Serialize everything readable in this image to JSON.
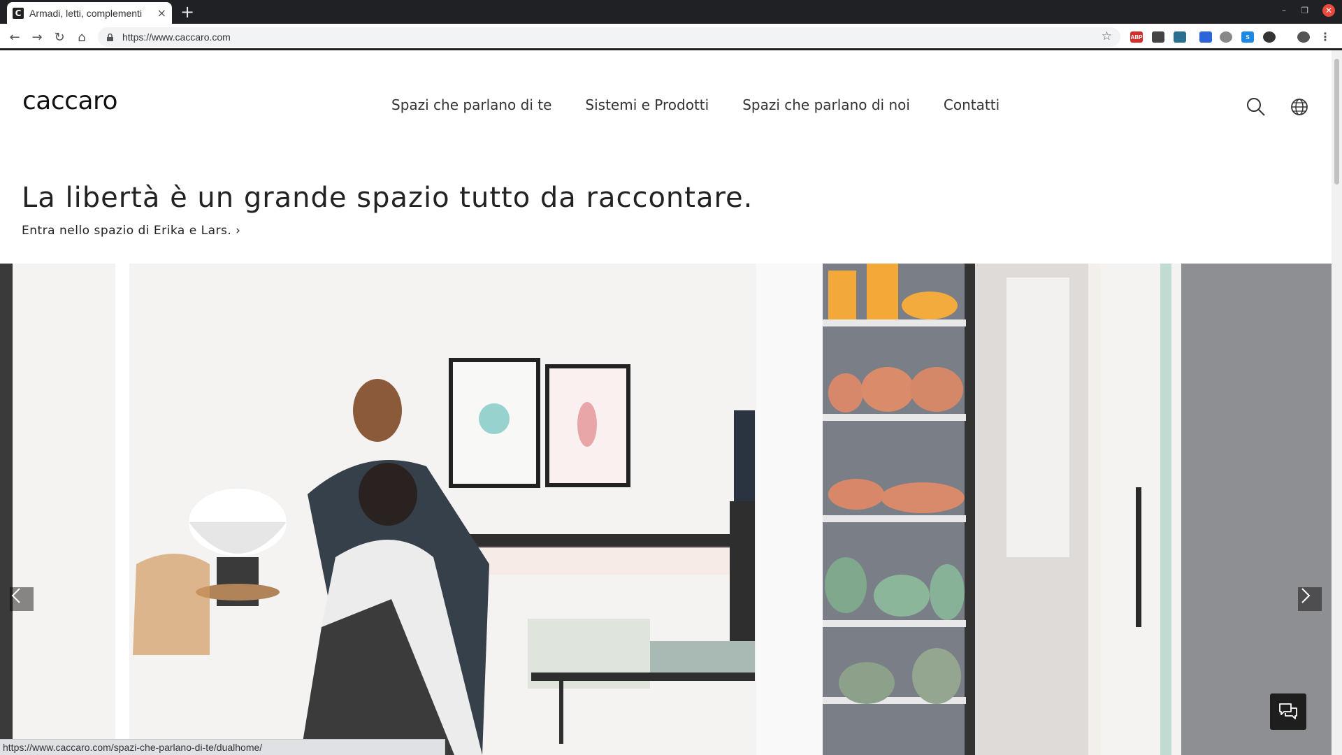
{
  "browser": {
    "tab_title": "Armadi, letti, complementi",
    "tab_close": "×",
    "new_tab": "+",
    "url": "https://www.caccaro.com",
    "status_url": "https://www.caccaro.com/spazi-che-parlano-di-te/dualhome/",
    "extensions": [
      "ABP",
      "",
      "",
      "",
      "",
      "S",
      "",
      ""
    ]
  },
  "site": {
    "logo": "caccaro",
    "nav": [
      "Spazi che parlano di te",
      "Sistemi e Prodotti",
      "Spazi che parlano di noi",
      "Contatti"
    ],
    "headline": "La libertà è un grande spazio tutto da raccontare.",
    "sublink": "Entra nello spazio di Erika e Lars. ›"
  },
  "icons": {
    "search": "search-icon",
    "language": "globe-icon",
    "prev": "chevron-left-icon",
    "next": "chevron-right-icon",
    "chat": "chat-icon"
  }
}
